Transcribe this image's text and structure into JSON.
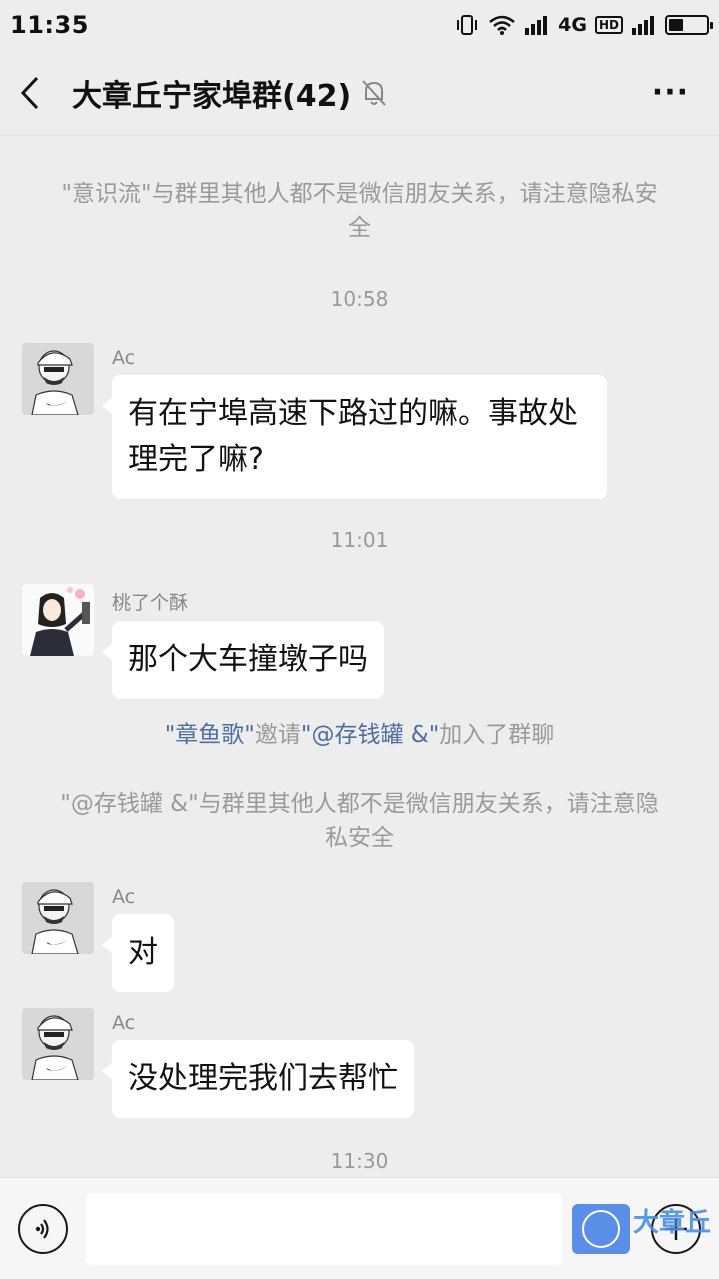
{
  "status_bar": {
    "time": "11:35",
    "network": "4G",
    "hd": "HD"
  },
  "header": {
    "title": "大章丘宁家埠群(42)",
    "back_icon": "back-arrow-icon",
    "mute_icon": "bell-off-icon",
    "more_label": "···"
  },
  "chat": {
    "system_1": "\"意识流\"与群里其他人都不是微信朋友关系，请注意隐私安全",
    "time_1": "10:58",
    "msg_1": {
      "sender": "Ac",
      "text": "有在宁埠高速下路过的嘛。事故处理完了嘛?"
    },
    "time_2": "11:01",
    "msg_2": {
      "sender": "桃了个酥",
      "text": "那个大车撞墩子吗"
    },
    "invite": {
      "inviter": "\"章鱼歌\"",
      "verb": "邀请",
      "invitee": "\"@存钱罐 &\"",
      "tail": "加入了群聊"
    },
    "system_2": "\"@存钱罐 &\"与群里其他人都不是微信朋友关系，请注意隐私安全",
    "msg_3": {
      "sender": "Ac",
      "text": "对"
    },
    "msg_4": {
      "sender": "Ac",
      "text": "没处理完我们去帮忙"
    },
    "time_3": "11:30"
  },
  "input_bar": {
    "voice_icon": "voice-icon",
    "emoji_icon": "emoji-icon",
    "plus_icon": "plus-icon",
    "watermark": "大章丘"
  }
}
